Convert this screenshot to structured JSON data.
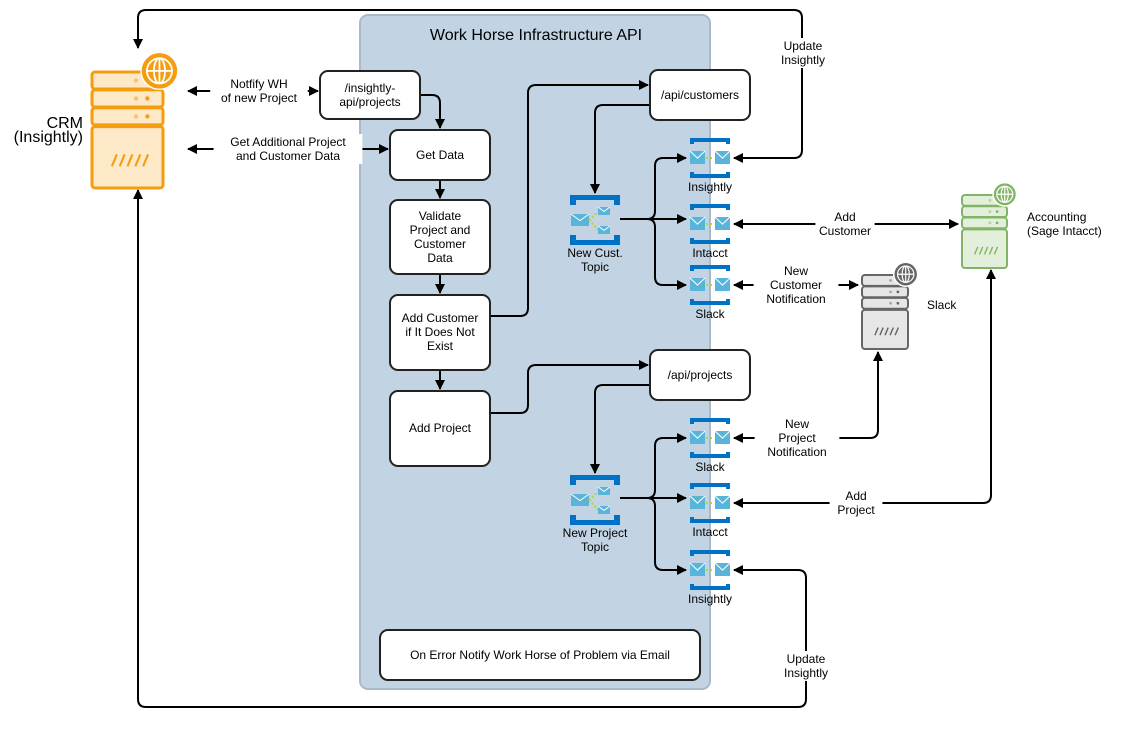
{
  "container": {
    "title": "Work Horse Infrastructure API",
    "fill": "#c2d4e3",
    "stroke": "#a9b9c8"
  },
  "boxes": {
    "insightly_api": [
      "/insightly-",
      "api/projects"
    ],
    "get_data": [
      "Get Data"
    ],
    "validate": [
      "Validate",
      "Project and",
      "Customer",
      "Data"
    ],
    "add_customer": [
      "Add Customer",
      "if It Does Not",
      "Exist"
    ],
    "add_project": [
      "Add Project"
    ],
    "api_customers": [
      "/api/customers"
    ],
    "api_projects": [
      "/api/projects"
    ],
    "on_error": [
      "On Error Notify Work Horse of Problem via Email"
    ]
  },
  "topics": {
    "customer": [
      "New Cust.",
      "Topic"
    ],
    "project": [
      "New Project",
      "Topic"
    ]
  },
  "subscriptions": {
    "cust_insightly": "Insightly",
    "cust_intacct": "Intacct",
    "cust_slack": "Slack",
    "proj_slack": "Slack",
    "proj_intacct": "Intacct",
    "proj_insightly": "Insightly"
  },
  "systems": {
    "crm": {
      "label": [
        "CRM",
        "(Insightly)"
      ],
      "color": "#f59d0e",
      "fill": "#fde8c8",
      "icon": "server-globe-icon"
    },
    "slack": {
      "label": [
        "Slack"
      ],
      "color": "#666666",
      "fill": "#e6e6e6",
      "icon": "server-globe-icon"
    },
    "accounting": {
      "label": [
        "Accounting",
        "(Sage Intacct)"
      ],
      "color": "#82b366",
      "fill": "#e2efda",
      "icon": "server-globe-icon"
    }
  },
  "edge_labels": {
    "notify_wh": [
      "Notfify WH",
      "of new Project"
    ],
    "get_additional": [
      "Get Additional Project",
      "and Customer Data"
    ],
    "update_insightly_top": [
      "Update",
      "Insightly"
    ],
    "add_customer": [
      "Add",
      "Customer"
    ],
    "new_customer_notification": [
      "New",
      "Customer",
      "Notification"
    ],
    "new_project_notification": [
      "New",
      "Project",
      "Notification"
    ],
    "add_project": [
      "Add",
      "Project"
    ],
    "update_insightly_bottom": [
      "Update",
      "Insightly"
    ]
  },
  "colors": {
    "azure_blue": "#0072c6",
    "azure_light": "#59b4d9",
    "azure_green": "#b8d432"
  }
}
